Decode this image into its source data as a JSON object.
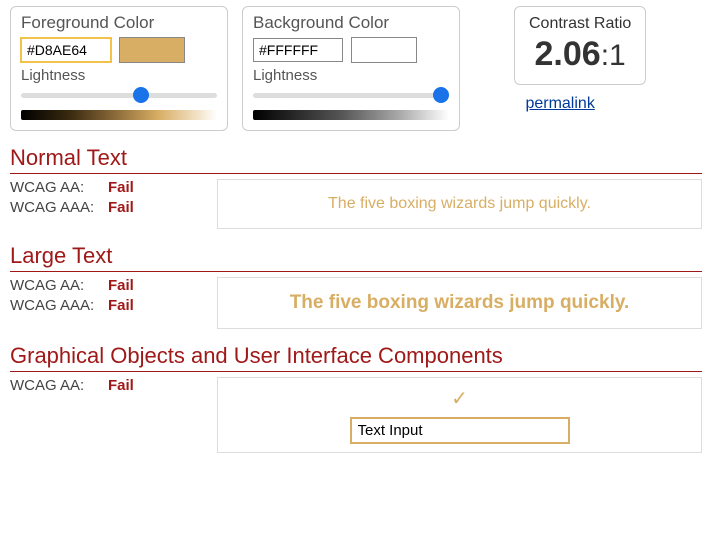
{
  "fg": {
    "title": "Foreground Color",
    "hex": "#D8AE64",
    "lightness_label": "Lightness",
    "lightness": 62
  },
  "bg": {
    "title": "Background Color",
    "hex": "#FFFFFF",
    "lightness_label": "Lightness",
    "lightness": 100
  },
  "ratio": {
    "label": "Contrast Ratio",
    "value": "2.06",
    "suffix": ":1"
  },
  "permalink": "permalink",
  "sections": {
    "normal": {
      "title": "Normal Text",
      "aa_label": "WCAG AA:",
      "aa": "Fail",
      "aaa_label": "WCAG AAA:",
      "aaa": "Fail",
      "sample": "The five boxing wizards jump quickly."
    },
    "large": {
      "title": "Large Text",
      "aa_label": "WCAG AA:",
      "aa": "Fail",
      "aaa_label": "WCAG AAA:",
      "aaa": "Fail",
      "sample": "The five boxing wizards jump quickly."
    },
    "ui": {
      "title": "Graphical Objects and User Interface Components",
      "aa_label": "WCAG AA:",
      "aa": "Fail",
      "check": "✓",
      "input_value": "Text Input"
    }
  },
  "colors": {
    "fg": "#D8AE64",
    "bg": "#FFFFFF"
  }
}
